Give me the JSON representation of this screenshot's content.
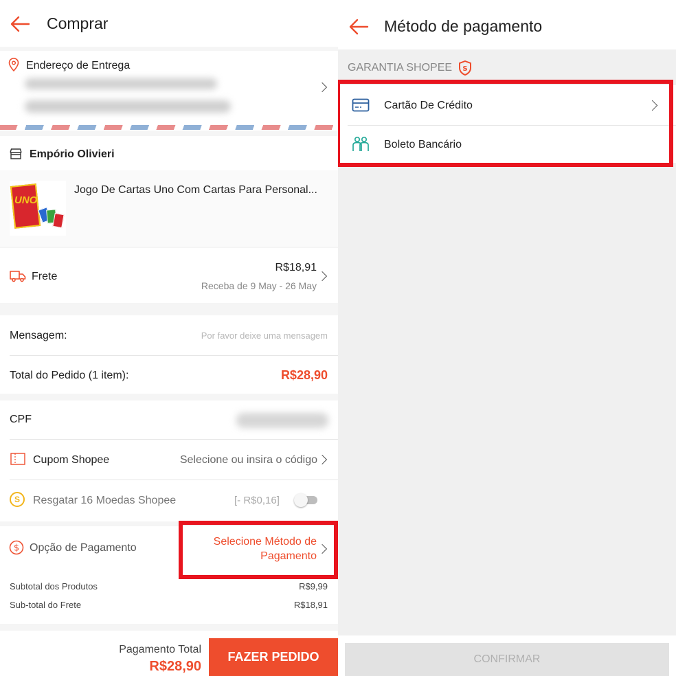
{
  "checkout": {
    "title": "Comprar",
    "address": {
      "label": "Endereço de Entrega"
    },
    "shop": {
      "name": "Empório Olivieri"
    },
    "product": {
      "name": "Jogo De Cartas Uno Com Cartas Para Personal...",
      "image_text": "UNO"
    },
    "shipping": {
      "label": "Frete",
      "price": "R$18,91",
      "eta": "Receba de 9 May - 26 May"
    },
    "message": {
      "label": "Mensagem:",
      "placeholder": "Por favor deixe uma mensagem"
    },
    "order_total": {
      "label": "Total do Pedido (1 item):",
      "value": "R$28,90"
    },
    "cpf": {
      "label": "CPF"
    },
    "coupon": {
      "label": "Cupom Shopee",
      "value": "Selecione ou insira o código"
    },
    "coins": {
      "label": "Resgatar 16 Moedas Shopee",
      "value": "[- R$0,16]",
      "enabled": false
    },
    "payment": {
      "label": "Opção de Pagamento",
      "value_line1": "Selecione Método de",
      "value_line2": "Pagamento"
    },
    "subtotal_products": {
      "label": "Subtotal dos Produtos",
      "value": "R$9,99"
    },
    "subtotal_shipping": {
      "label": "Sub-total do Frete",
      "value": "R$18,91"
    },
    "footer": {
      "total_label": "Pagamento Total",
      "total_value": "R$28,90",
      "button": "FAZER PEDIDO"
    }
  },
  "payment_method": {
    "title": "Método de pagamento",
    "section": "GARANTIA SHOPEE",
    "options": [
      {
        "label": "Cartão De Crédito",
        "icon": "credit-card-icon"
      },
      {
        "label": "Boleto Bancário",
        "icon": "boleto-icon"
      }
    ],
    "confirm": "CONFIRMAR"
  },
  "colors": {
    "accent": "#ee4d2d",
    "highlight": "#e8141e",
    "teal": "#26aa99",
    "card_blue": "#2b5f9e"
  }
}
